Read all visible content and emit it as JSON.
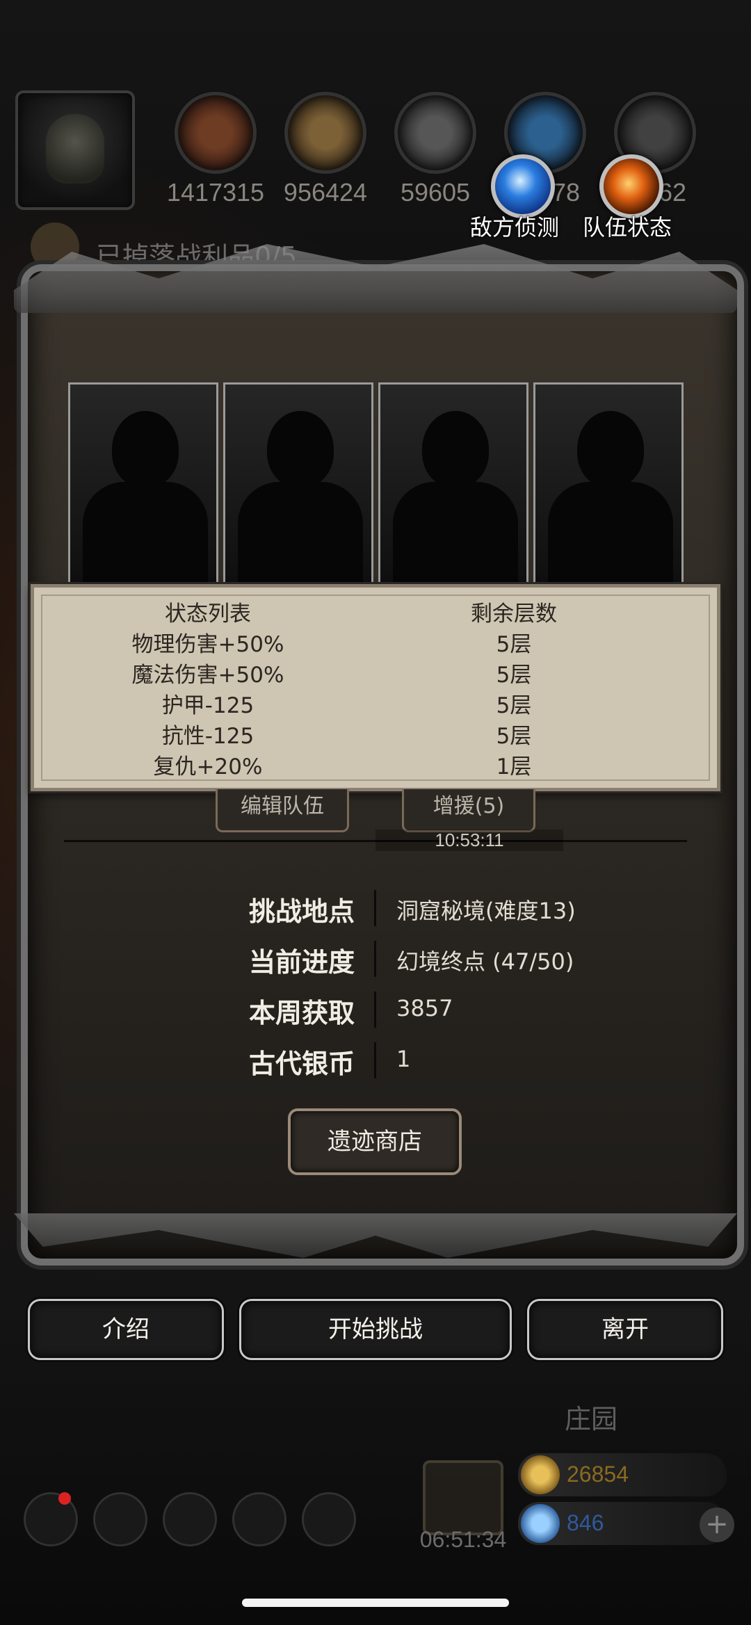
{
  "resources": [
    {
      "icon": "meat-icon",
      "value": "1417315"
    },
    {
      "icon": "wood-icon",
      "value": "956424"
    },
    {
      "icon": "iron-icon",
      "value": "59605"
    },
    {
      "icon": "crystal-icon",
      "value": "978"
    },
    {
      "icon": "ore-icon",
      "value": "62"
    }
  ],
  "top_actions": {
    "enemy_scout": "敌方侦测",
    "team_status": "队伍状态"
  },
  "quest": {
    "text": "已掉落战利品0/5"
  },
  "status_popup": {
    "header_left": "状态列表",
    "header_right": "剩余层数",
    "rows": [
      {
        "name": "物理伤害+50%",
        "stacks": "5层"
      },
      {
        "name": "魔法伤害+50%",
        "stacks": "5层"
      },
      {
        "name": "护甲-125",
        "stacks": "5层"
      },
      {
        "name": "抗性-125",
        "stacks": "5层"
      },
      {
        "name": "复仇+20%",
        "stacks": "1层"
      }
    ]
  },
  "panel": {
    "edit_team": "编辑队伍",
    "reinforce": "增援(5)",
    "timer": "10:53:11",
    "info": [
      {
        "key": "挑战地点",
        "value": "洞窟秘境(难度13)"
      },
      {
        "key": "当前进度",
        "value": "幻境终点 (47/50)"
      },
      {
        "key": "本周获取",
        "value": "3857"
      },
      {
        "key": "古代银币",
        "value": "1"
      }
    ],
    "shop_button": "遗迹商店"
  },
  "buttons": {
    "intro": "介绍",
    "start": "开始挑战",
    "leave": "离开"
  },
  "bottom": {
    "manor": "庄园",
    "gold": "26854",
    "gems": "846",
    "gift_timer": "06:51:34"
  },
  "colors": {
    "panel_bg": "#2b2722",
    "status_bg": "#cfc5b3",
    "gold_text": "#8a6a20",
    "gem_text": "#2f5a9a"
  }
}
